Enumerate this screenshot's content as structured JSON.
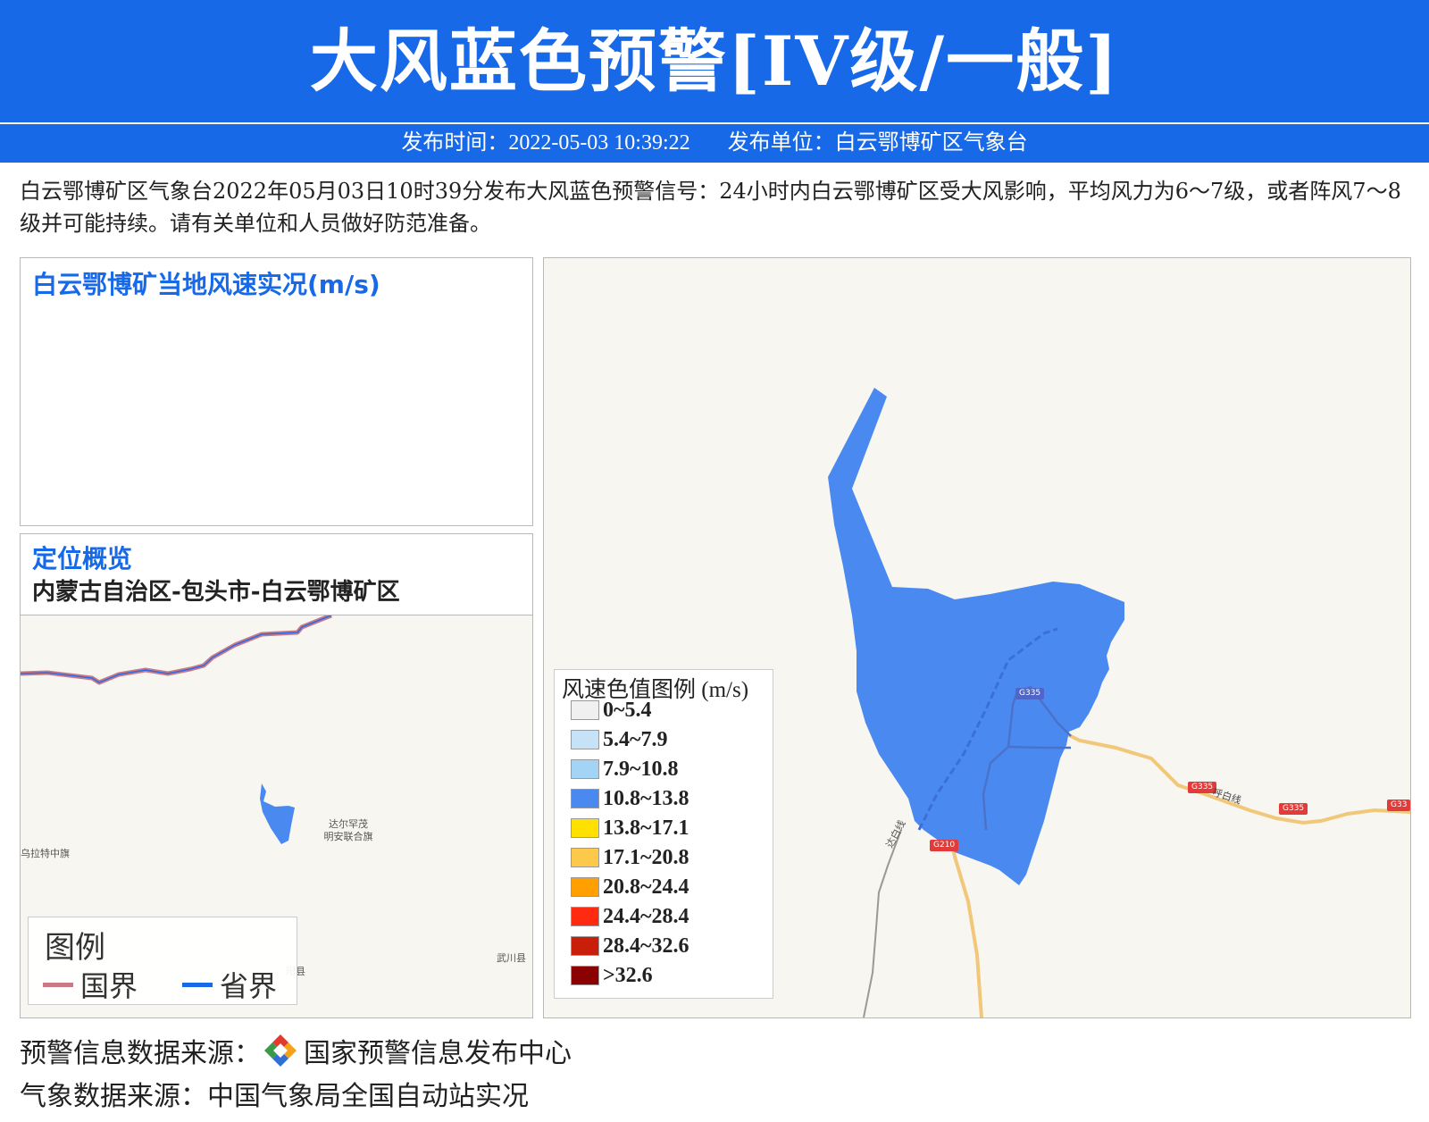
{
  "header": {
    "title": "大风蓝色预警[IV级/一般]"
  },
  "subheader": {
    "publish_time": "发布时间：2022-05-03 10:39:22",
    "publisher": "发布单位：白云鄂博矿区气象台"
  },
  "description": "白云鄂博矿区气象台2022年05月03日10时39分发布大风蓝色预警信号：24小时内白云鄂博矿区受大风影响，平均风力为6～7级，或者阵风7～8级并可能持续。请有关单位和人员做好防范准备。",
  "wind_panel": {
    "title": "白云鄂博矿当地风速实况(m/s)"
  },
  "location_panel": {
    "title": "定位概览",
    "region": "内蒙古自治区-包头市-白云鄂博矿区",
    "map_labels": [
      "达尔罕茂",
      "明安联合旗",
      "乌拉特中旗",
      "武川县",
      "阳县"
    ],
    "legend": {
      "title": "图例",
      "items": [
        {
          "label": "国界",
          "color": "#c97a86"
        },
        {
          "label": "省界",
          "color": "#1769e8"
        }
      ]
    }
  },
  "wind_map": {
    "area_color": "#4a8af0",
    "road_labels": [
      "G335",
      "G335",
      "G335",
      "G33",
      "G210",
      "呼白线",
      "达白线"
    ],
    "legend": {
      "title": "风速色值图例 (m/s)",
      "items": [
        {
          "label": "0~5.4",
          "color": "#f0f0f0"
        },
        {
          "label": "5.4~7.9",
          "color": "#c6e2f7"
        },
        {
          "label": "7.9~10.8",
          "color": "#a3d4f5"
        },
        {
          "label": "10.8~13.8",
          "color": "#4a8af0"
        },
        {
          "label": "13.8~17.1",
          "color": "#ffe000"
        },
        {
          "label": "17.1~20.8",
          "color": "#fcc94a"
        },
        {
          "label": "20.8~24.4",
          "color": "#ffa000"
        },
        {
          "label": "24.4~28.4",
          "color": "#ff2a10"
        },
        {
          "label": "28.4~32.6",
          "color": "#c81e0a"
        },
        {
          "label": ">32.6",
          "color": "#8b0000"
        }
      ]
    }
  },
  "footer": {
    "warning_source_label": "预警信息数据来源：",
    "warning_source_name": "国家预警信息发布中心",
    "weather_source": "气象数据来源：中国气象局全国自动站实况"
  }
}
